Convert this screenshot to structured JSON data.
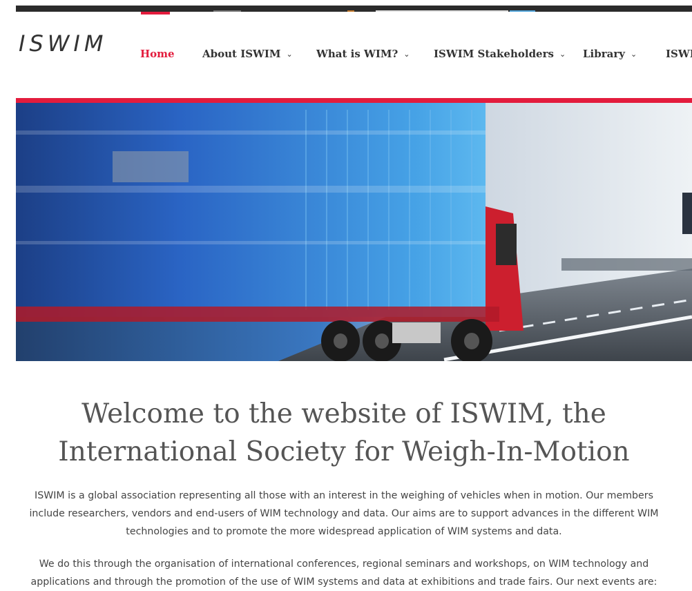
{
  "site": {
    "logo_text": "ISWIM",
    "accent_color": "#e31c3d"
  },
  "nav": {
    "items": [
      {
        "label": "Home",
        "active": true,
        "has_dropdown": false
      },
      {
        "label": "About ISWIM",
        "active": false,
        "has_dropdown": true
      },
      {
        "label": "What is WIM?",
        "active": false,
        "has_dropdown": true
      },
      {
        "label": "ISWIM Stakeholders",
        "active": false,
        "has_dropdown": true
      },
      {
        "label": "Library",
        "active": false,
        "has_dropdown": true
      },
      {
        "label": "ISWI",
        "active": false,
        "has_dropdown": false
      }
    ],
    "dropdown_glyph": "⌄"
  },
  "hero": {
    "image_description_icon": "truck-photo"
  },
  "main": {
    "heading": "Welcome to the website of ISWIM, the International Society for Weigh-In-Motion",
    "paragraph_1": "ISWIM is a global association representing all those with an interest in the weighing of vehicles when in motion. Our members include researchers, vendors and end-users of WIM technology and data. Our aims are to support advances in the different WIM technologies and to promote the more widespread application of WIM systems and data.",
    "paragraph_2": "We do this through the organisation of international conferences, regional seminars and workshops, on WIM technology and applications and through the promotion of the use of WIM systems and data at exhibitions and trade fairs. Our next events are:"
  }
}
